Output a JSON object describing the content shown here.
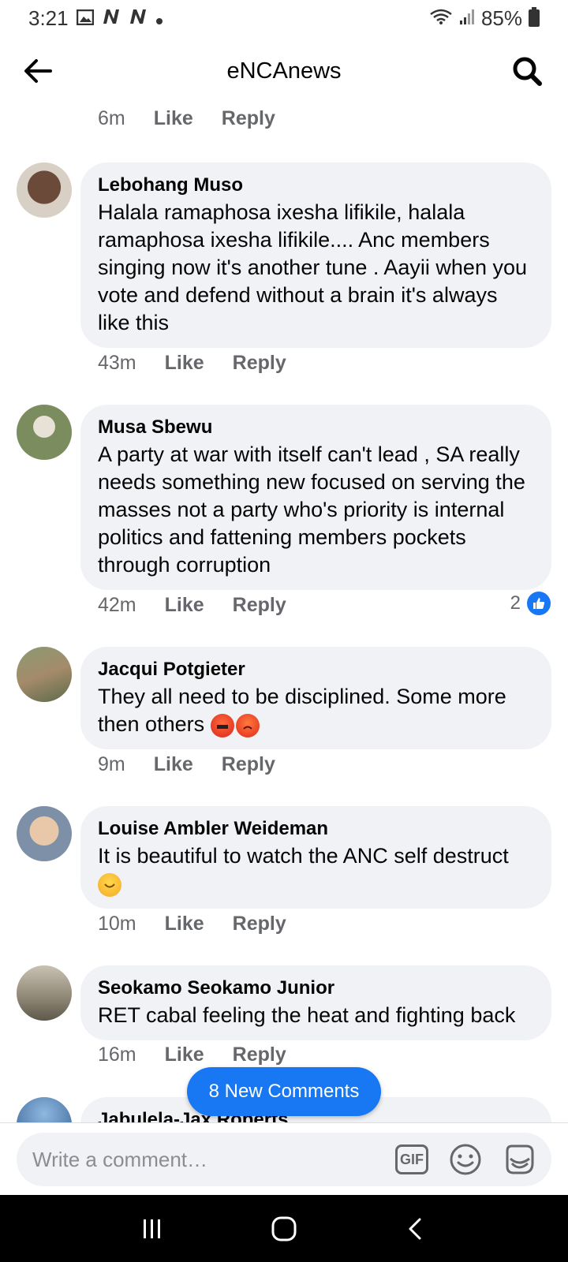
{
  "status_bar": {
    "time": "3:21",
    "battery": "85%"
  },
  "header": {
    "title": "eNCAnews"
  },
  "top_meta": {
    "time": "6m",
    "like": "Like",
    "reply": "Reply"
  },
  "comments": [
    {
      "name": "Lebohang Muso",
      "text": "Halala ramaphosa ixesha lifikile, halala ramaphosa ixesha lifikile.... Anc members singing now it's another tune . Aayii when you vote and defend without a brain it's always like this",
      "time": "43m",
      "like": "Like",
      "reply": "Reply"
    },
    {
      "name": "Musa Sbewu",
      "text": "A party at war with itself can't lead , SA really needs something new focused on serving the masses not a party who's priority is internal politics and fattening members pockets through corruption",
      "time": "42m",
      "like": "Like",
      "reply": "Reply",
      "reactions": "2"
    },
    {
      "name": "Jacqui Potgieter",
      "text": "They all need to be disciplined. Some more then others",
      "time": "9m",
      "like": "Like",
      "reply": "Reply"
    },
    {
      "name": "Louise Ambler Weideman",
      "text": "It is beautiful to watch the ANC self destruct",
      "time": "10m",
      "like": "Like",
      "reply": "Reply"
    },
    {
      "name": "Seokamo Seokamo Junior",
      "text": "RET cabal feeling the heat and  fighting back",
      "time": "16m",
      "like": "Like",
      "reply": "Reply"
    },
    {
      "name": "Jabulela-Jax Roberts"
    }
  ],
  "new_comments_pill": "8 New Comments",
  "composer": {
    "placeholder": "Write a comment…",
    "gif": "GIF"
  },
  "colors": {
    "accent": "#1877f2",
    "bubble": "#f0f2f5",
    "meta": "#65676b"
  },
  "icons": [
    "back-arrow-icon",
    "search-icon",
    "gif-icon",
    "emoji-icon",
    "sticker-icon",
    "recents-icon",
    "home-icon",
    "back-nav-icon"
  ]
}
